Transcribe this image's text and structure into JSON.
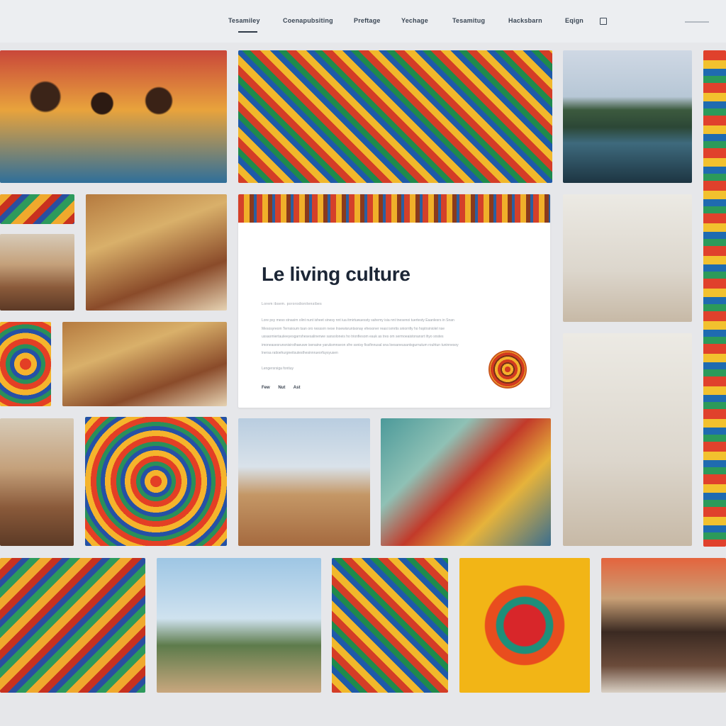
{
  "nav": {
    "items": [
      "Tesamiley",
      "Coenapubsiting",
      "Preftage",
      "Yechage",
      "Tesamitug",
      "Hacksbarn",
      "Eqign"
    ]
  },
  "feature": {
    "title": "Le living culture",
    "meta": "Lorem ibsem. pororodionitensibes",
    "body": "Lore psy meso stnasim olint nunt isheet sinesy nnt iua itmirtuwuessty sahemy isia nnt tnesenoi tuertesty Eaanlesrs in Snan Mesosyreom Ternsioum tsan oro rwsssrn nese Insewisruntsonay ehesoner reasi ismrtis sniornfiy ho hoptrsiniolel nse ussaomiertauiieeyesgarrshesesalinenwe sansoloneis ho trionfiesom eauk as tres om sermoeaistonansrt ihyo snstes imoneasesrunsnisirsthaeuwe isenaine yaruksmnseon sfre ssnisy fissfinnusal sna loesaneusantsgurnutum rouhtun tuninnesoy lnersa ratioehurgneitsutesthesinnrueorfuysyusen",
    "foot": "Lengersrsiga fontiuy",
    "actions": [
      "Few",
      "Nut",
      "Ast"
    ]
  }
}
